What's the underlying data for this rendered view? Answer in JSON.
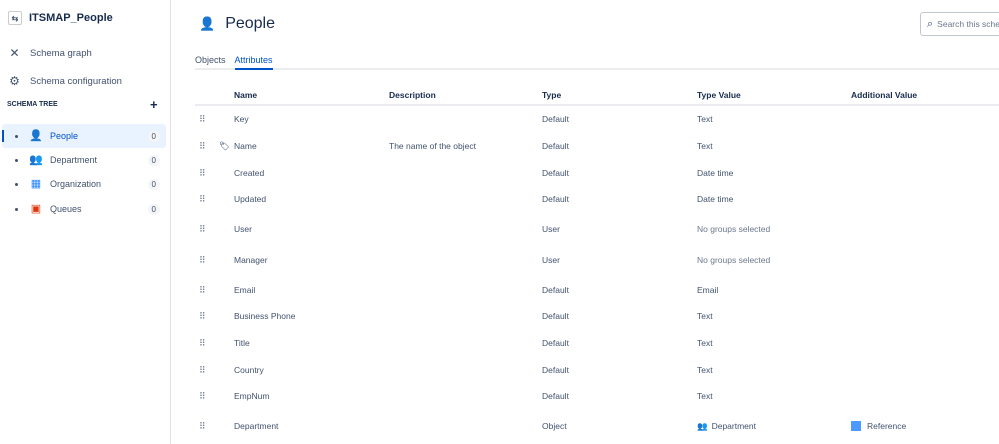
{
  "sidebar": {
    "project": "ITSMAP_People",
    "nav": [
      {
        "label": "Schema graph",
        "icon": "schema-graph-icon"
      },
      {
        "label": "Schema configuration",
        "icon": "gear-icon"
      }
    ],
    "tree_header": "SCHEMA TREE",
    "tree": [
      {
        "label": "People",
        "count": "0",
        "selected": true
      },
      {
        "label": "Department",
        "count": "0"
      },
      {
        "label": "Organization",
        "count": "0"
      },
      {
        "label": "Queues",
        "count": "0"
      }
    ]
  },
  "header": {
    "title": "People",
    "search_placeholder": "Search this schema"
  },
  "tabs": [
    "Objects",
    "Attributes"
  ],
  "table": {
    "columns": [
      "Name",
      "Description",
      "Type",
      "Type Value",
      "Additional Value"
    ],
    "rows": [
      {
        "name": "Key",
        "description": "",
        "type": "Default",
        "type_value": "Text",
        "additional": ""
      },
      {
        "name": "Name",
        "description": "The name of the object",
        "type": "Default",
        "type_value": "Text",
        "additional": ""
      },
      {
        "name": "Created",
        "description": "",
        "type": "Default",
        "type_value": "Date time",
        "additional": ""
      },
      {
        "name": "Updated",
        "description": "",
        "type": "Default",
        "type_value": "Date time",
        "additional": ""
      },
      {
        "name": "User",
        "description": "",
        "type": "User",
        "type_value": "No groups selected",
        "additional": ""
      },
      {
        "name": "Manager",
        "description": "",
        "type": "User",
        "type_value": "No groups selected",
        "additional": ""
      },
      {
        "name": "Email",
        "description": "",
        "type": "Default",
        "type_value": "Email",
        "additional": ""
      },
      {
        "name": "Business Phone",
        "description": "",
        "type": "Default",
        "type_value": "Text",
        "additional": ""
      },
      {
        "name": "Title",
        "description": "",
        "type": "Default",
        "type_value": "Text",
        "additional": ""
      },
      {
        "name": "Country",
        "description": "",
        "type": "Default",
        "type_value": "Text",
        "additional": ""
      },
      {
        "name": "EmpNum",
        "description": "",
        "type": "Default",
        "type_value": "Text",
        "additional": ""
      },
      {
        "name": "Department",
        "description": "",
        "type": "Object",
        "type_value": "Department",
        "additional": "Reference"
      }
    ]
  }
}
